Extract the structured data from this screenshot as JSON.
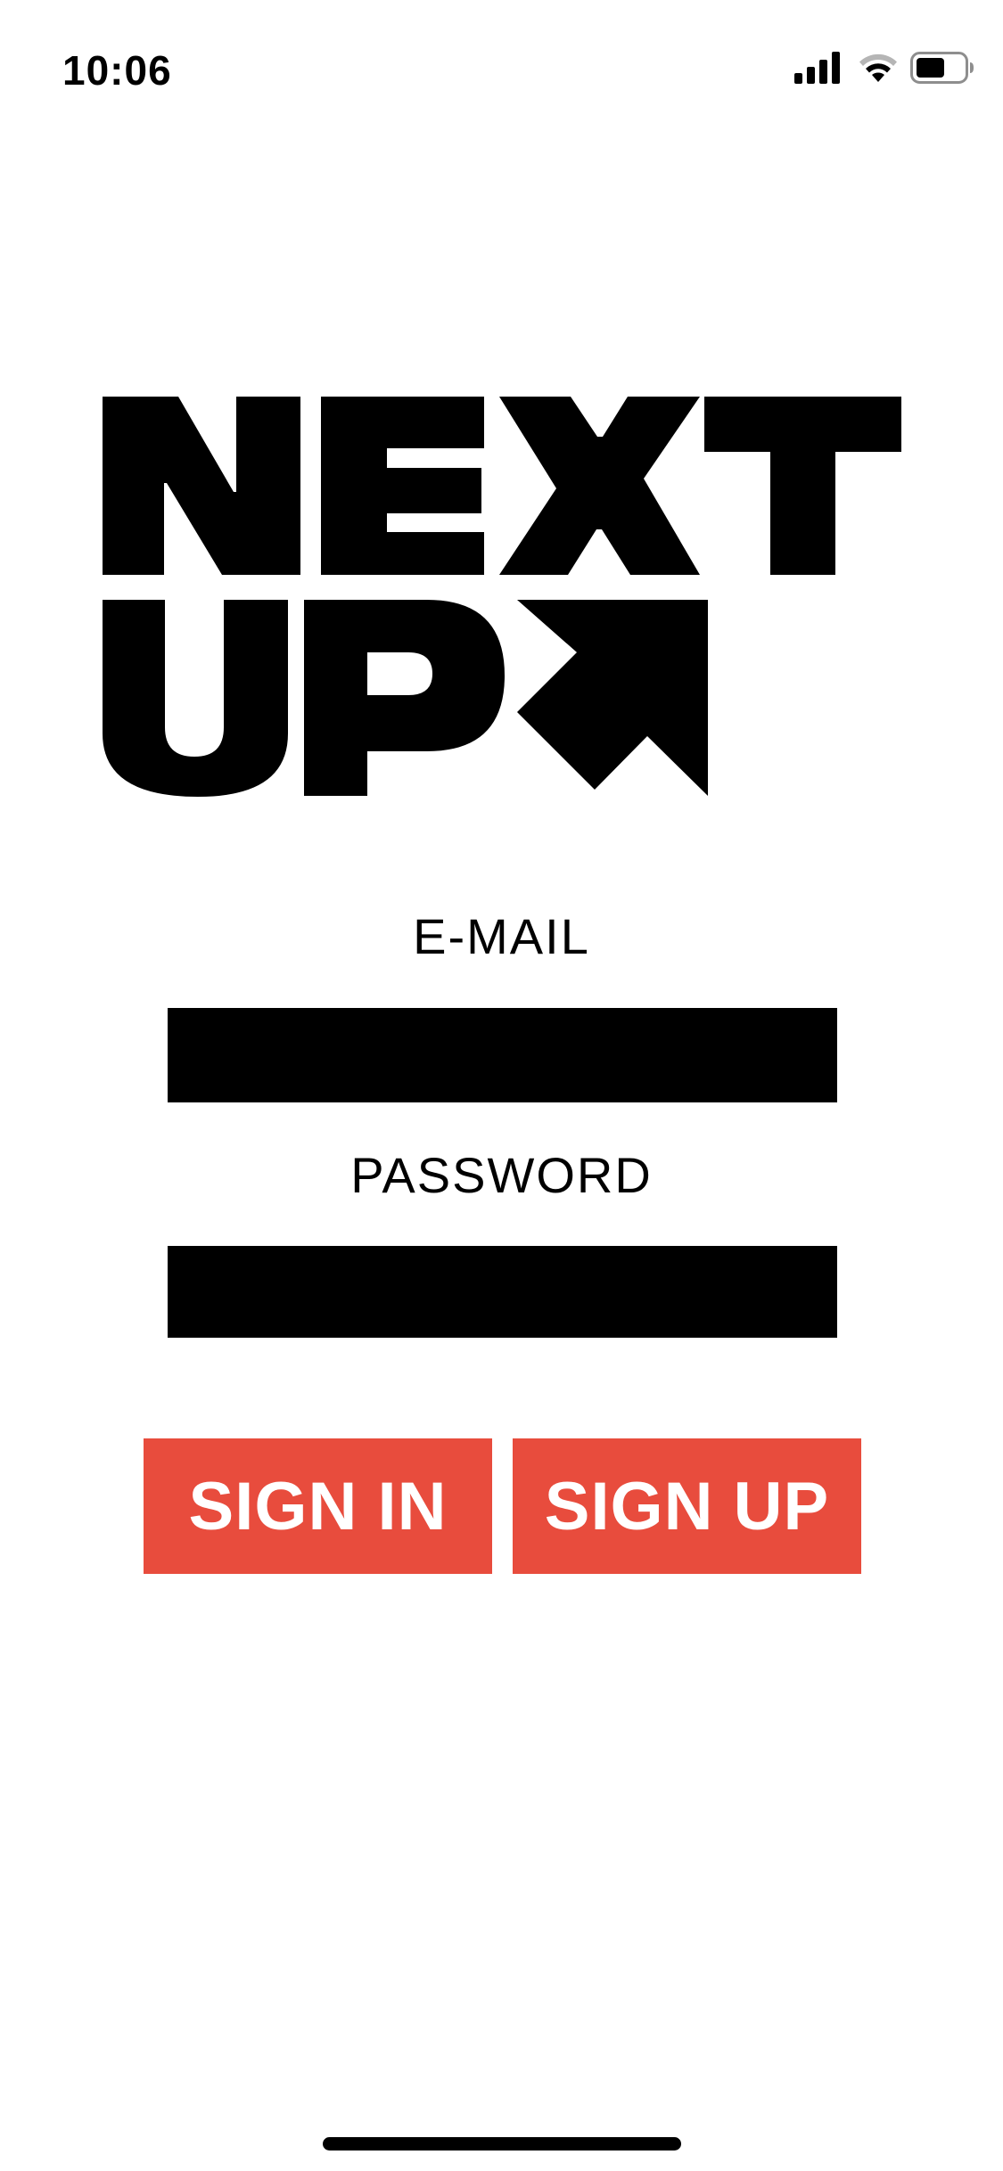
{
  "status_bar": {
    "time": "10:06",
    "signal_icon": "cellular-signal-icon",
    "wifi_icon": "wifi-icon",
    "battery_icon": "battery-icon"
  },
  "logo": {
    "line1": "NEXT",
    "line2": "UP",
    "arrow_icon": "arrow-up-right-icon"
  },
  "form": {
    "email_label": "E-MAIL",
    "email_value": "",
    "password_label": "PASSWORD",
    "password_value": ""
  },
  "actions": {
    "sign_in_label": "SIGN IN",
    "sign_up_label": "SIGN UP"
  },
  "colors": {
    "accent": "#e84c3d",
    "text": "#000000",
    "background": "#ffffff"
  }
}
